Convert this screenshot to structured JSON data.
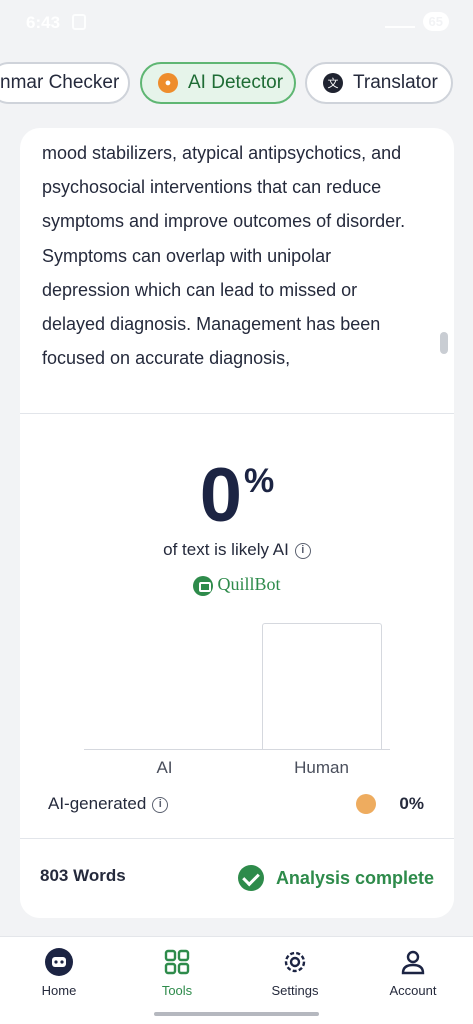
{
  "status_bar": {
    "time": "6:43",
    "battery": "65"
  },
  "tools": [
    {
      "label": "Grammar Checker",
      "visible_label": "nmar Checker"
    },
    {
      "label": "AI Detector",
      "active": true
    },
    {
      "label": "Translator"
    }
  ],
  "document_text": "mood stabilizers, atypical antipsychotics, and psychosocial interventions that can reduce symptoms and improve outcomes of disorder. Symptoms can overlap with unipolar depression which can lead to missed or delayed diagnosis. Management has been focused on accurate diagnosis,",
  "result": {
    "percent_value": "0",
    "percent_sign": "%",
    "caption": "of text is likely AI",
    "brand": "QuillBot"
  },
  "chart_data": {
    "type": "bar",
    "categories": [
      "AI",
      "Human"
    ],
    "values": [
      0,
      100
    ],
    "ylim": [
      0,
      100
    ],
    "colors": [
      "#eeac5f",
      "#ffffff"
    ]
  },
  "breakdown": [
    {
      "label": "AI-generated",
      "value": "0%",
      "color": "#eeac5f"
    }
  ],
  "footer": {
    "word_count": "803 Words",
    "status": "Analysis complete"
  },
  "nav": [
    {
      "label": "Home",
      "icon": "robot-home-icon"
    },
    {
      "label": "Tools",
      "icon": "grid-icon",
      "active": true
    },
    {
      "label": "Settings",
      "icon": "gear-icon"
    },
    {
      "label": "Account",
      "icon": "person-icon"
    }
  ],
  "colors": {
    "accent": "#2e8b4b",
    "ai_dot": "#eeac5f",
    "dark": "#1c2443"
  }
}
